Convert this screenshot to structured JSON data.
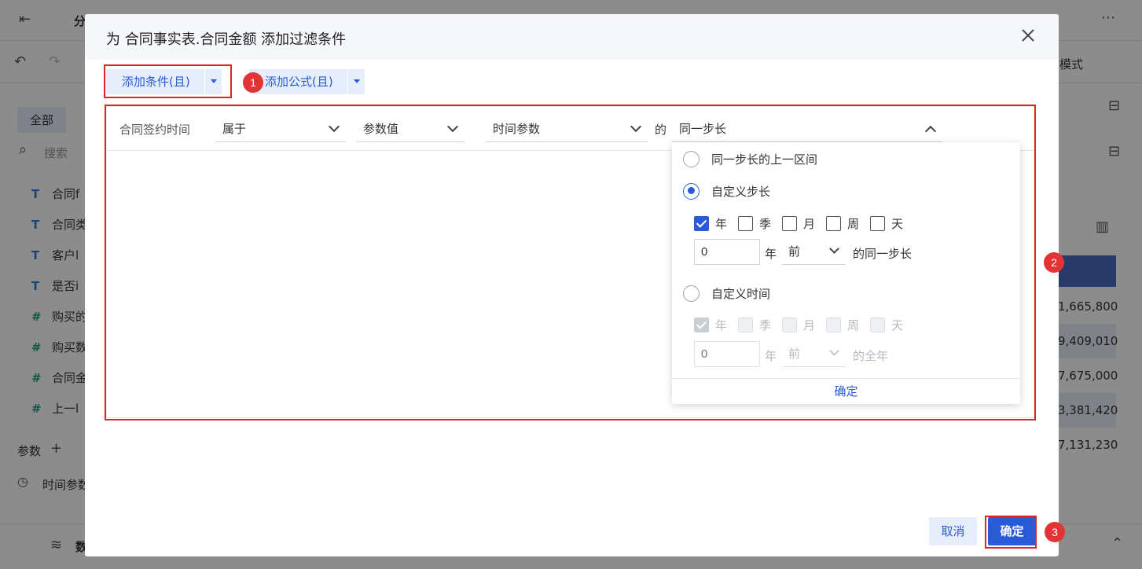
{
  "background": {
    "top_title": "分",
    "mode_label": "模式",
    "sidebar_tab": "全部",
    "search_placeholder": "搜索",
    "fields": [
      {
        "icon": "T",
        "label": "合同f"
      },
      {
        "icon": "T",
        "label": "合同类"
      },
      {
        "icon": "T",
        "label": "客户l"
      },
      {
        "icon": "T",
        "label": "是否i"
      },
      {
        "icon": "#",
        "label": "购买的"
      },
      {
        "icon": "#",
        "label": "购买数"
      },
      {
        "icon": "#",
        "label": "合同金"
      },
      {
        "icon": "#",
        "label": "上一l"
      }
    ],
    "param_label": "参数",
    "time_param_label": "时间参数",
    "bottom_label": "数",
    "table_values": [
      "1,665,800",
      "9,409,010",
      "7,675,000",
      "3,381,420",
      "7,131,230"
    ]
  },
  "dialog": {
    "title": "为 合同事实表.合同金额 添加过滤条件",
    "add_condition_label": "添加条件(且)",
    "add_formula_label": "添加公式(且)",
    "condition": {
      "field": "合同签约时间",
      "operator": "属于",
      "value_type": "参数值",
      "parameter": "时间参数",
      "connector": "的",
      "step_mode": "同一步长"
    },
    "panel": {
      "option_prev_interval": "同一步长的上一区间",
      "option_custom_step": "自定义步长",
      "option_custom_time": "自定义时间",
      "units": [
        "年",
        "季",
        "月",
        "周",
        "天"
      ],
      "custom_step": {
        "checked": [
          true,
          false,
          false,
          false,
          false
        ],
        "offset_value": "0",
        "unit_label": "年",
        "direction": "前",
        "suffix": "的同一步长"
      },
      "custom_time": {
        "checked": [
          true,
          false,
          false,
          false,
          false
        ],
        "offset_placeholder": "0",
        "unit_label": "年",
        "direction": "前",
        "suffix": "的全年"
      },
      "confirm_label": "确定"
    },
    "cancel_label": "取消",
    "ok_label": "确定"
  },
  "markers": [
    "1",
    "2",
    "3"
  ]
}
